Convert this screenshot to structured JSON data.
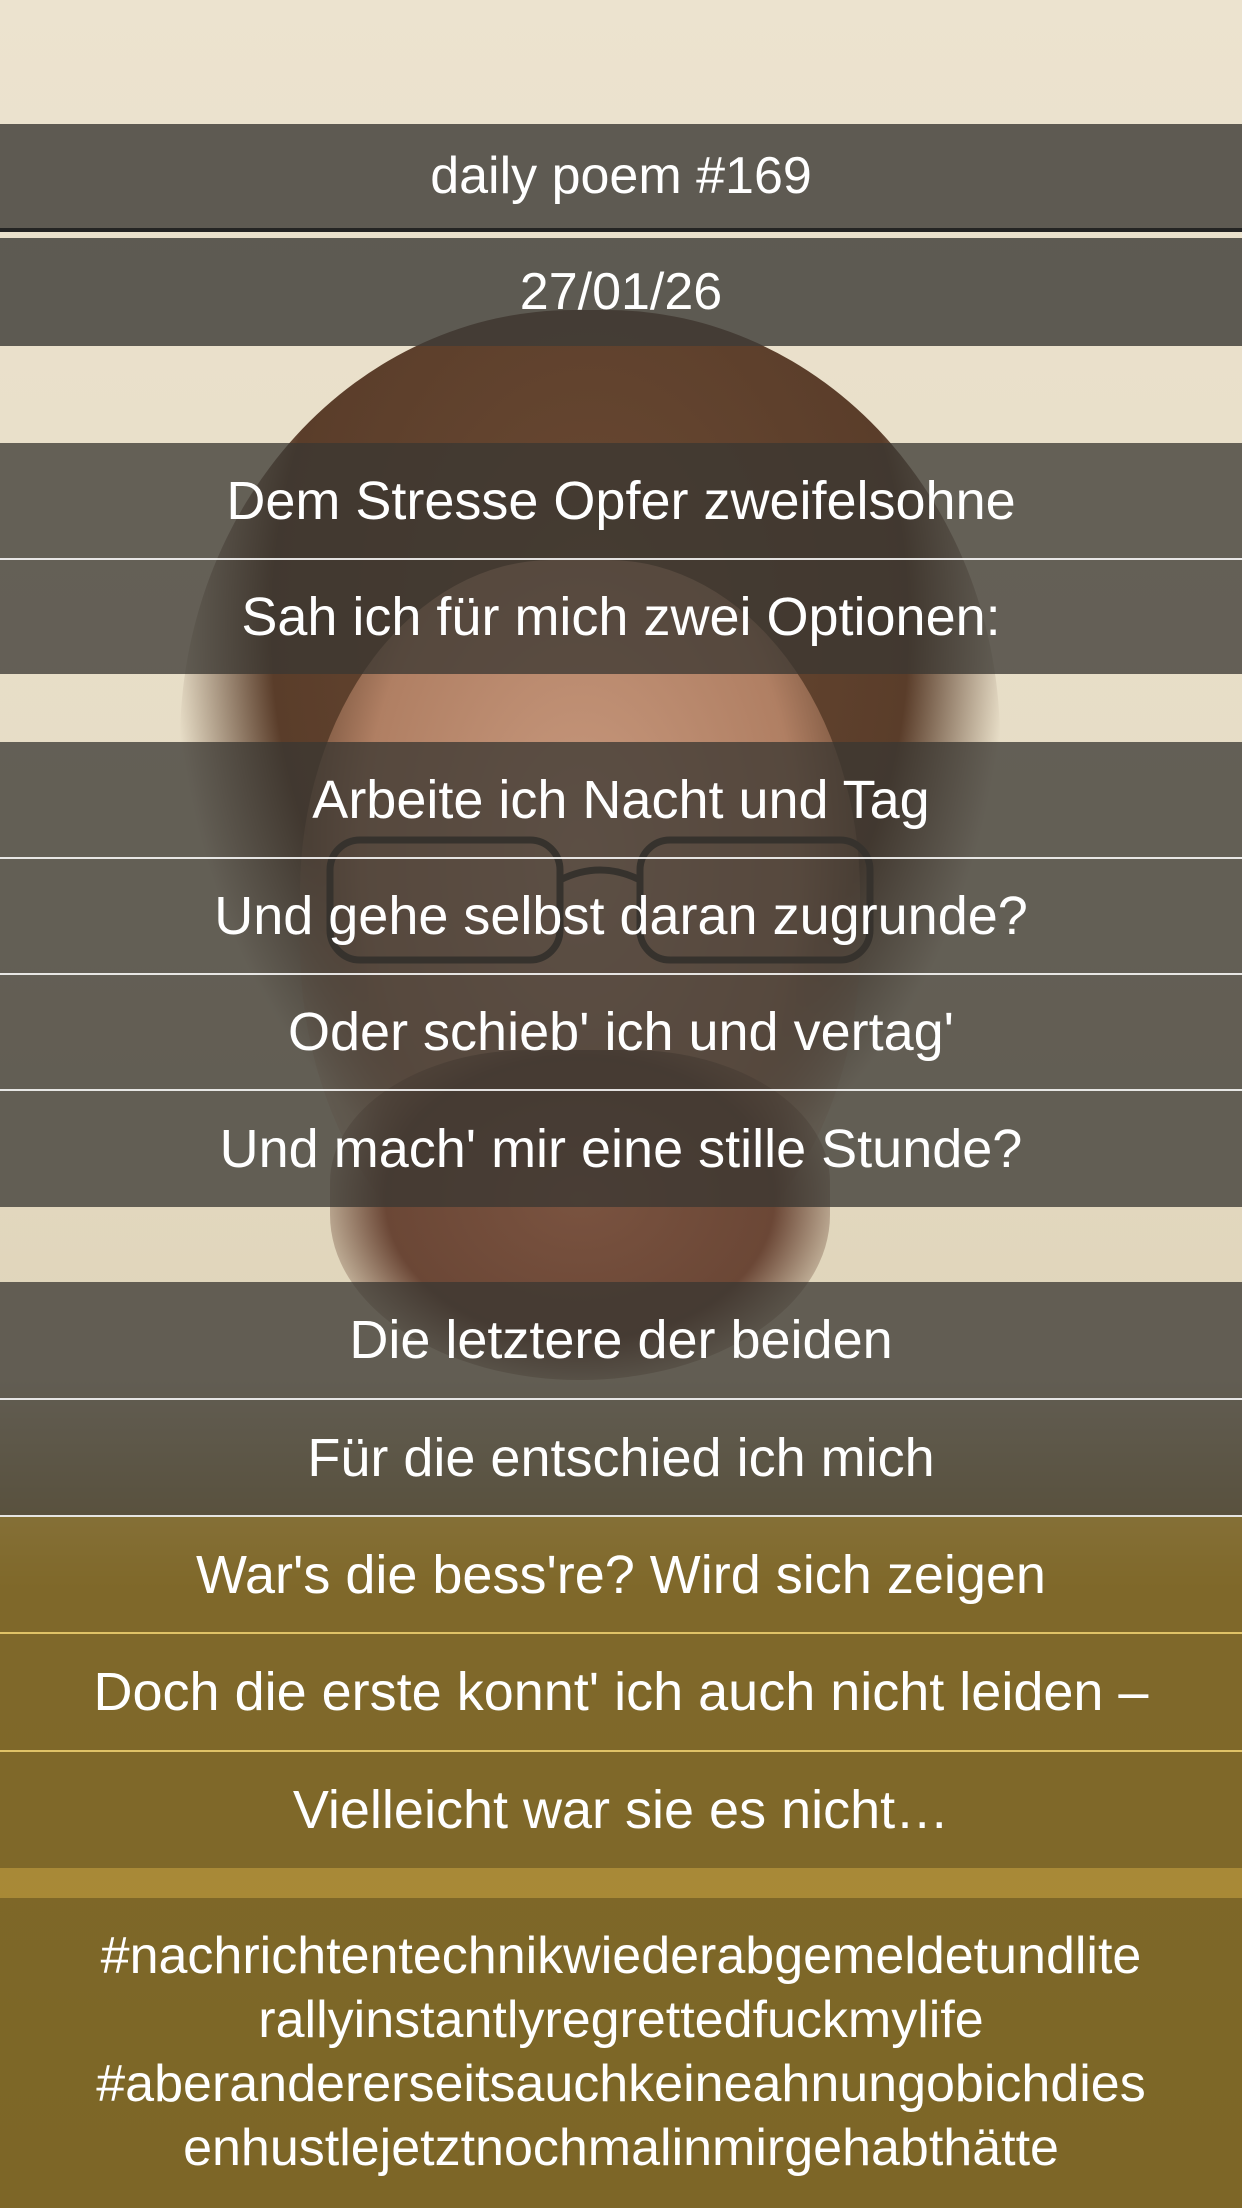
{
  "header": {
    "title": "daily poem #169",
    "date": "27/01/26"
  },
  "stanzas": [
    {
      "lines": [
        "Dem Stresse Opfer zweifelsohne",
        "Sah ich für mich zwei Optionen:"
      ]
    },
    {
      "lines": [
        "Arbeite ich Nacht und Tag",
        "Und gehe selbst daran zugrunde?",
        "Oder schieb' ich und vertag'",
        "Und mach' mir eine stille Stunde?"
      ]
    },
    {
      "lines": [
        "Die letztere der beiden",
        "Für die entschied ich mich",
        "War's die bess're? Wird sich zeigen",
        "Doch die erste konnt' ich auch nicht leiden –",
        "Vielleicht war sie es nicht…"
      ]
    }
  ],
  "hashtags": [
    "#nachrichtentechnikwiederabgemeldetundlite",
    "rallyinstantlyregrettedfuckmylife",
    "#aberandererseitsauchkeineahnungobichdies",
    "enhustlejetztnochmalinmirgehabthätte"
  ],
  "photo": {
    "subject_icon": "selfie-photo"
  }
}
